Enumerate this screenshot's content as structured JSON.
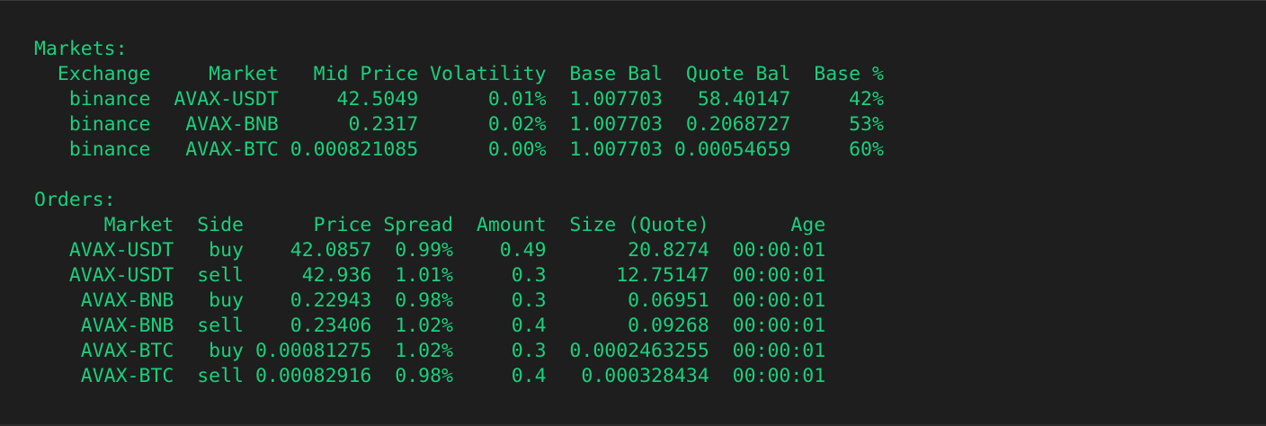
{
  "terminal": {
    "lines": [
      "Markets:",
      "  Exchange     Market   Mid Price Volatility  Base Bal  Quote Bal  Base %",
      "   binance  AVAX-USDT     42.5049      0.01%  1.007703   58.40147     42%",
      "   binance   AVAX-BNB      0.2317      0.02%  1.007703  0.2068727     53%",
      "   binance   AVAX-BTC 0.000821085      0.00%  1.007703 0.00054659     60%",
      "",
      "Orders:",
      "      Market  Side      Price Spread  Amount  Size (Quote)       Age",
      "   AVAX-USDT   buy    42.0857  0.99%    0.49       20.8274  00:00:01",
      "   AVAX-USDT  sell     42.936  1.01%     0.3      12.75147  00:00:01",
      "    AVAX-BNB   buy    0.22943  0.98%     0.3       0.06951  00:00:01",
      "    AVAX-BNB  sell    0.23406  1.02%     0.4       0.09268  00:00:01",
      "    AVAX-BTC   buy 0.00081275  1.02%     0.3  0.0002463255  00:00:01",
      "    AVAX-BTC  sell 0.00082916  0.98%     0.4   0.000328434  00:00:01"
    ]
  },
  "colors": {
    "background": "#1e1e1e",
    "text": "#19d07c"
  }
}
